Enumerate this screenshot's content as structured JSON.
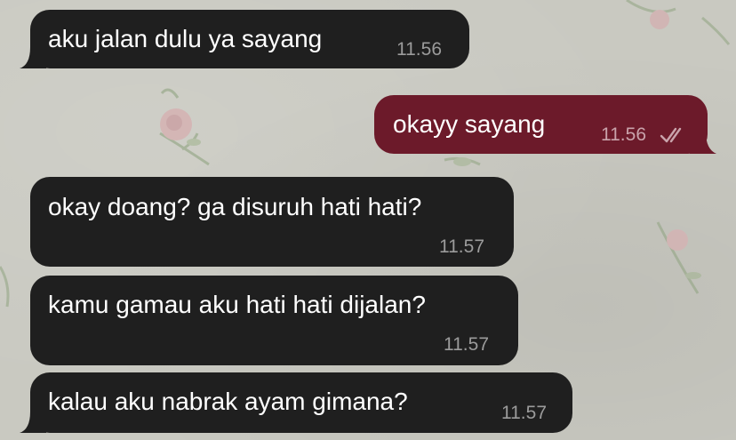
{
  "colors": {
    "wallpaper": "#c9c9c1",
    "incoming_bubble": "#1f1f1f",
    "outgoing_bubble": "#6c1a2a",
    "text": "#ffffff",
    "timestamp": "#9b9b9b"
  },
  "messages": [
    {
      "direction": "incoming",
      "text": "aku jalan dulu ya sayang",
      "time": "11.56"
    },
    {
      "direction": "outgoing",
      "text": "okayy sayang",
      "time": "11.56",
      "status_icon": "double-check-icon"
    },
    {
      "direction": "incoming",
      "text": "okay doang? ga disuruh hati hati?",
      "time": "11.57"
    },
    {
      "direction": "incoming",
      "text": "kamu gamau aku hati hati dijalan?",
      "time": "11.57"
    },
    {
      "direction": "incoming",
      "text": "kalau aku nabrak ayam gimana?",
      "time": "11.57"
    }
  ]
}
